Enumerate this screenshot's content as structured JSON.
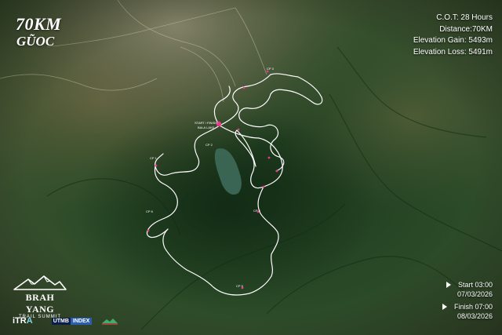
{
  "map": {
    "title": "70KM",
    "subtitle": "GŨOC",
    "stats": {
      "cot": "C.O.T: 28 Hours",
      "distance": "Distance:70KM",
      "elevation_gain": "Elevation Gain: 5493m",
      "elevation_loss": "Elevation Loss: 5491m"
    },
    "schedule": {
      "start_time": "Start 03:00",
      "start_date": "07/03/2026",
      "finish_time": "Finish 07:00",
      "finish_date": "08/03/2026"
    },
    "brand": {
      "name": "BRAH YANG",
      "tagline": "TRAIL SUMMIT"
    },
    "partners": {
      "itra_prefix": "iTR",
      "itra_suffix": "A",
      "utmb": "UTMB",
      "utmb_index": "INDEX"
    },
    "route_color": "#ffffff",
    "marker_color": "#e8398a",
    "checkpoints": [
      {
        "id": "cp-start",
        "label": "START / FINISH"
      },
      {
        "id": "cp-lake",
        "label": "BALA LAKE"
      },
      {
        "id": "cp-2",
        "label": "CP 2"
      },
      {
        "id": "cp-3",
        "label": "CP 3"
      },
      {
        "id": "cp-4",
        "label": "CP 4"
      },
      {
        "id": "cp-5",
        "label": "CP 5"
      },
      {
        "id": "cp-6",
        "label": "CP 6"
      },
      {
        "id": "cp-1",
        "label": "CP 1"
      }
    ]
  }
}
